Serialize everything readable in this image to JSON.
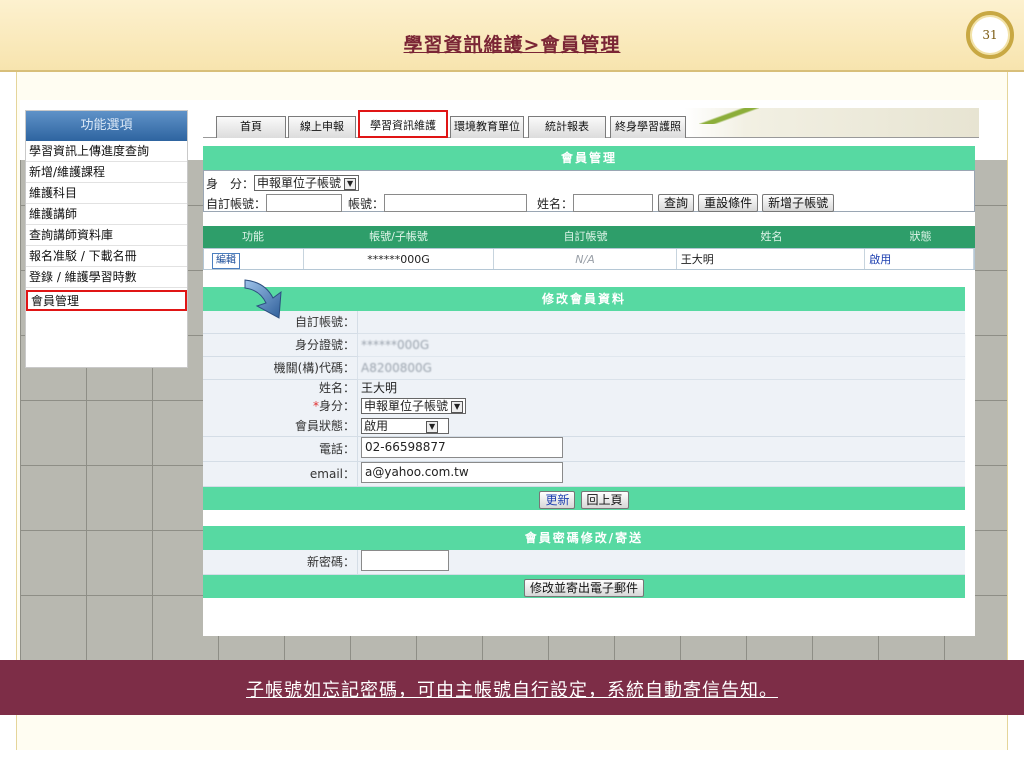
{
  "slide": {
    "title": "學習資訊維護>會員管理",
    "page_number": "31",
    "footer_note": "子帳號如忘記密碼，可由主帳號自行設定，系統自動寄信告知。"
  },
  "sidebar": {
    "title": "功能選項",
    "items": [
      {
        "label": "學習資訊上傳進度查詢"
      },
      {
        "label": "新增/維護課程"
      },
      {
        "label": "維護科目"
      },
      {
        "label": "維護講師"
      },
      {
        "label": "查詢講師資料庫"
      },
      {
        "label": "報名准駁 / 下載名冊"
      },
      {
        "label": "登錄 / 維護學習時數"
      },
      {
        "label": "會員管理"
      }
    ]
  },
  "tabs": [
    {
      "label": "首頁"
    },
    {
      "label": "線上申報"
    },
    {
      "label": "學習資訊維護"
    },
    {
      "label": "環境教育單位"
    },
    {
      "label": "統計報表"
    },
    {
      "label": "終身學習護照"
    }
  ],
  "member_mgmt": {
    "header": "會員管理",
    "identity_label": "身　分：",
    "identity_value": "申報單位子帳號",
    "custom_account_label": "自訂帳號：",
    "account_label": "帳號：",
    "name_label": "姓名：",
    "query_button": "查詢",
    "reset_button": "重設條件",
    "add_sub_button": "新增子帳號",
    "columns": [
      "功能",
      "帳號/子帳號",
      "自訂帳號",
      "姓名",
      "狀態"
    ],
    "rows": [
      {
        "action": "編輯",
        "account": "******000G",
        "custom_account": "N/A",
        "name": "王大明",
        "status": "啟用"
      }
    ]
  },
  "edit_member": {
    "header": "修改會員資料",
    "fields": {
      "custom_account_label": "自訂帳號：",
      "custom_account_value": "",
      "id_label": "身分證號：",
      "id_value": "******000G",
      "org_code_label": "機關(構)代碼：",
      "org_code_value": "A8200800G",
      "name_label": "姓名：",
      "name_value": "王大明",
      "identity_req": "*",
      "identity_label": "身分：",
      "identity_value": "申報單位子帳號",
      "status_label": "會員狀態：",
      "status_value": "啟用",
      "phone_label": "電話：",
      "phone_value": "02-66598877",
      "email_label": "email：",
      "email_value": "a@yahoo.com.tw"
    },
    "update_button": "更新",
    "back_button": "回上頁"
  },
  "password": {
    "header": "會員密碼修改/寄送",
    "new_password_label": "新密碼：",
    "new_password_value": "",
    "send_button": "修改並寄出電子郵件"
  }
}
